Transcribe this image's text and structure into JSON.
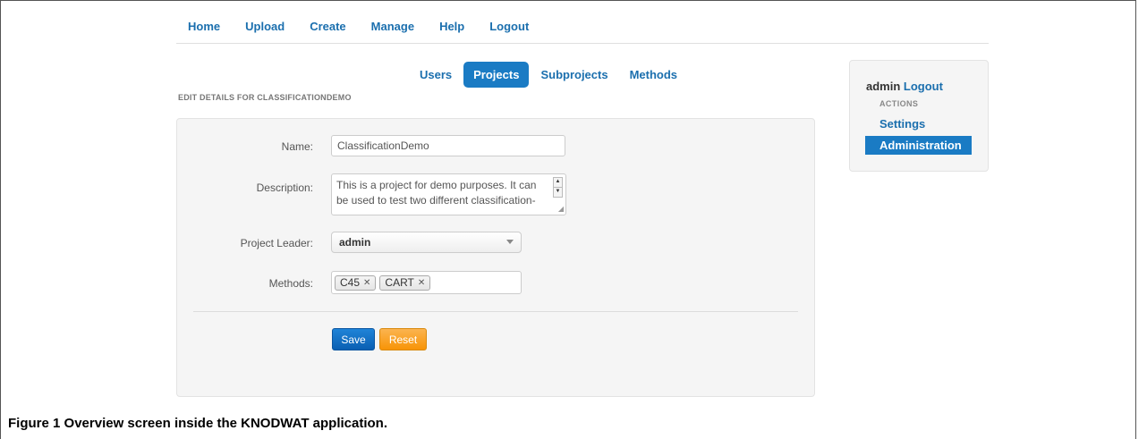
{
  "nav": {
    "items": [
      "Home",
      "Upload",
      "Create",
      "Manage",
      "Help",
      "Logout"
    ]
  },
  "subnav": {
    "tabs": [
      {
        "label": "Users",
        "active": false
      },
      {
        "label": "Projects",
        "active": true
      },
      {
        "label": "Subprojects",
        "active": false
      },
      {
        "label": "Methods",
        "active": false
      }
    ]
  },
  "page": {
    "heading": "EDIT DETAILS FOR CLASSIFICATIONDEMO"
  },
  "form": {
    "name_label": "Name:",
    "name_value": "ClassificationDemo",
    "description_label": "Description:",
    "description_value": "This is a project for demo purposes. It can be used to test two different classification-",
    "leader_label": "Project Leader:",
    "leader_value": "admin",
    "methods_label": "Methods:",
    "methods": [
      "C45",
      "CART"
    ],
    "save_label": "Save",
    "reset_label": "Reset"
  },
  "sidebar": {
    "username": "admin",
    "logout_label": "Logout",
    "actions_heading": "ACTIONS",
    "settings_label": "Settings",
    "administration_label": "Administration"
  },
  "caption": {
    "label": "Figure 1",
    "text": "Overview screen inside the KNODWAT application."
  },
  "colors": {
    "link": "#1b6fae",
    "active_tab": "#1a7bc4",
    "save_button": "#0a5fb2",
    "reset_button": "#f89406",
    "panel_bg": "#f5f5f5"
  }
}
